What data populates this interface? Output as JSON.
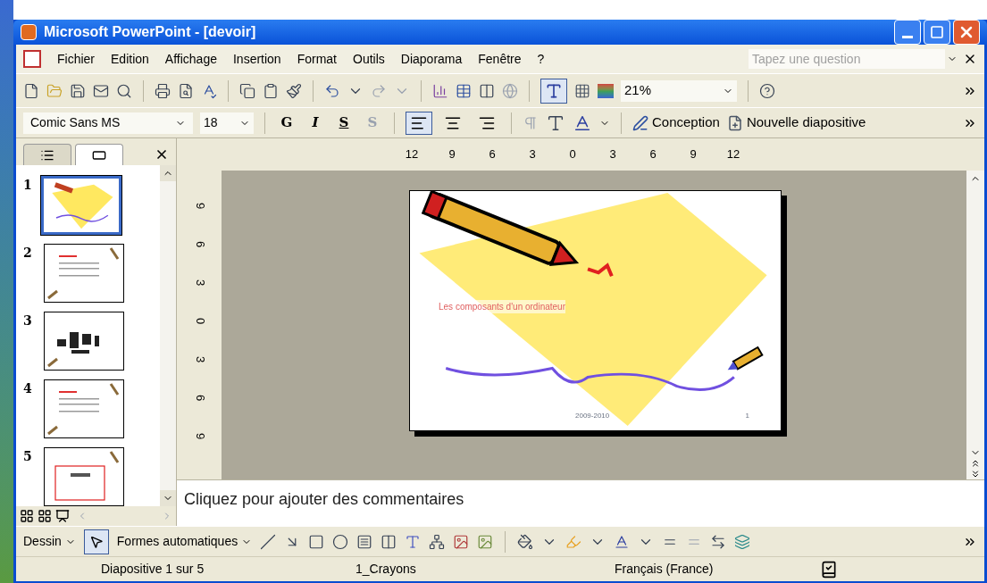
{
  "window": {
    "title": "Microsoft PowerPoint - [devoir]"
  },
  "menu": {
    "items": [
      "Fichier",
      "Edition",
      "Affichage",
      "Insertion",
      "Format",
      "Outils",
      "Diaporama",
      "Fenêtre",
      "?"
    ],
    "help_box": {
      "placeholder": "Tapez une question"
    }
  },
  "standard_toolbar": {
    "formatting_toggle_on": true,
    "zoom": "21%"
  },
  "formatting_toolbar": {
    "font": "Comic Sans MS",
    "size": "18",
    "styles": [
      {
        "kind": "bold",
        "label": "G"
      },
      {
        "kind": "italic",
        "label": "I"
      },
      {
        "kind": "underline",
        "label": "S"
      },
      {
        "kind": "shadow",
        "label": "S"
      }
    ],
    "alignment": [
      {
        "kind": "left",
        "selected": true
      },
      {
        "kind": "center",
        "selected": false
      },
      {
        "kind": "right",
        "selected": false
      }
    ],
    "buttons": [
      "Conception",
      "Nouvelle diapositive"
    ]
  },
  "pane_tabs": [
    {
      "kind": "outline",
      "selected": false
    },
    {
      "kind": "slides",
      "selected": true
    }
  ],
  "thumbnails": [
    {
      "number": "1",
      "kind": "title",
      "selected": true
    },
    {
      "number": "2",
      "kind": "text",
      "selected": false
    },
    {
      "number": "3",
      "kind": "devices",
      "selected": false
    },
    {
      "number": "4",
      "kind": "text",
      "selected": false
    },
    {
      "number": "5",
      "kind": "boxed",
      "selected": false
    }
  ],
  "rulers": {
    "horizontal": [
      "12",
      "9",
      "6",
      "3",
      "0",
      "3",
      "6",
      "9",
      "12"
    ],
    "vertical": [
      "9",
      "6",
      "3",
      "0",
      "3",
      "6",
      "9"
    ]
  },
  "slide": {
    "title": "Les composants d'un ordinateur",
    "footer": "2009-2010",
    "number": "1"
  },
  "notes": {
    "placeholder": "Cliquez pour ajouter des commentaires"
  },
  "drawing_toolbar": {
    "menu": "Dessin",
    "select_tool_on": true,
    "autoshapes": "Formes automatiques"
  },
  "status_bar": [
    "Diapositive 1 sur 5",
    "1_Crayons",
    "Français (France)"
  ]
}
